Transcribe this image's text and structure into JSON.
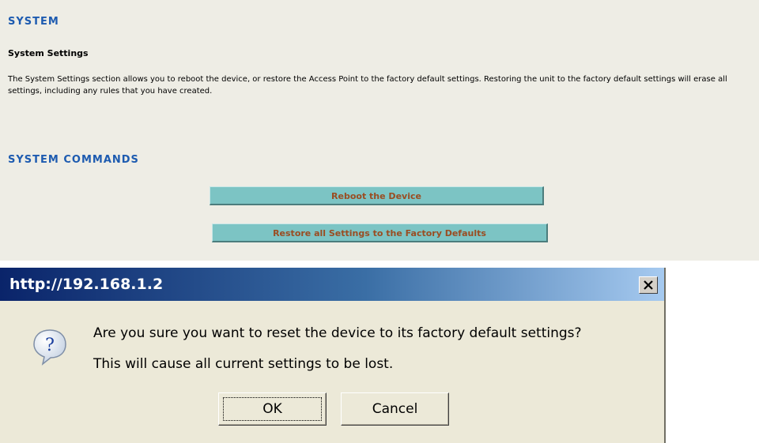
{
  "page": {
    "section_title": "SYSTEM",
    "subheading": "System Settings",
    "description": "The System Settings section allows you to reboot the device, or restore the Access Point to the factory default settings. Restoring the unit to the factory default settings will erase all settings, including any rules that you have created.",
    "commands_title": "SYSTEM COMMANDS",
    "reboot_button": "Reboot the Device",
    "restore_button": "Restore all Settings to the Factory Defaults"
  },
  "dialog": {
    "title": "http://192.168.1.2",
    "message_line1": "Are you sure you want to reset the device to its factory default settings?",
    "message_line2": "This will cause all current settings to be lost.",
    "ok_label": "OK",
    "cancel_label": "Cancel",
    "icon": "question-icon"
  },
  "colors": {
    "section_title": "#1d5bb0",
    "command_button_bg": "#7cc4c4",
    "command_button_text": "#9a4d22",
    "titlebar_start": "#0a246a",
    "titlebar_end": "#a6caf0"
  }
}
